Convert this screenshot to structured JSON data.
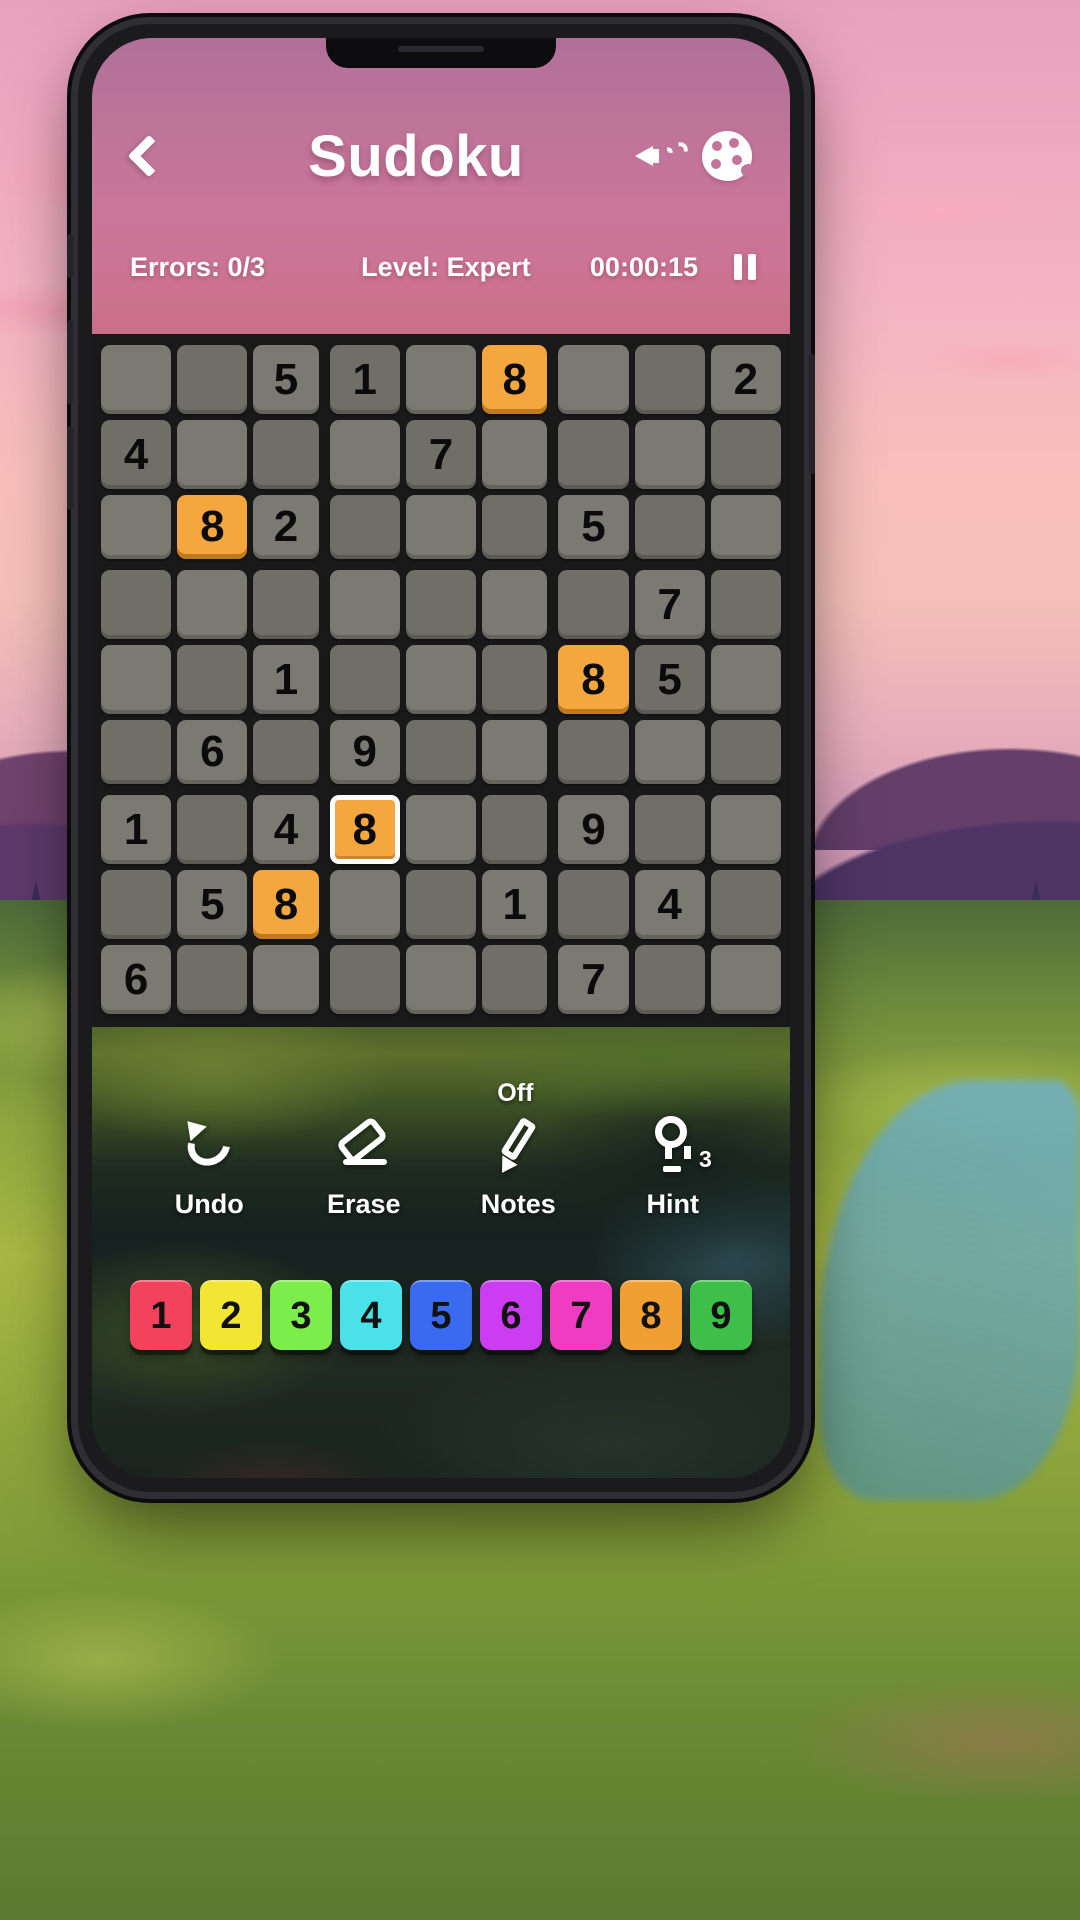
{
  "header": {
    "back_icon": "back-chevron-icon",
    "title": "Sudoku",
    "sound_icon": "sound-on-icon",
    "theme_icon": "palette-icon"
  },
  "status": {
    "errors": "Errors: 0/3",
    "level": "Level: Expert",
    "timer": "00:00:15",
    "pause_icon": "pause-icon"
  },
  "board": {
    "selected": {
      "row": 6,
      "col": 3
    },
    "highlight_value": "8",
    "rows": [
      [
        "",
        "",
        "5",
        "1",
        "",
        "8",
        "",
        "",
        "2"
      ],
      [
        "4",
        "",
        "",
        "",
        "7",
        "",
        "",
        "",
        ""
      ],
      [
        "",
        "8",
        "2",
        "",
        "",
        "",
        "5",
        "",
        ""
      ],
      [
        "",
        "",
        "",
        "",
        "",
        "",
        "",
        "7",
        ""
      ],
      [
        "",
        "",
        "1",
        "",
        "",
        "",
        "8",
        "5",
        ""
      ],
      [
        "",
        "6",
        "",
        "9",
        "",
        "",
        "",
        "",
        ""
      ],
      [
        "1",
        "",
        "4",
        "8",
        "",
        "",
        "9",
        "",
        ""
      ],
      [
        "",
        "5",
        "8",
        "",
        "",
        "1",
        "",
        "4",
        ""
      ],
      [
        "6",
        "",
        "",
        "",
        "",
        "",
        "7",
        "",
        ""
      ]
    ]
  },
  "tools": [
    {
      "id": "undo",
      "icon": "undo-icon",
      "label": "Undo",
      "badge": ""
    },
    {
      "id": "erase",
      "icon": "eraser-icon",
      "label": "Erase",
      "badge": ""
    },
    {
      "id": "notes",
      "icon": "pencil-icon",
      "label": "Notes",
      "badge": "Off"
    },
    {
      "id": "hint",
      "icon": "bulb-icon",
      "label": "Hint",
      "badge": "3"
    }
  ],
  "numpad": [
    {
      "label": "1",
      "color": "#f2425c"
    },
    {
      "label": "2",
      "color": "#f2e534"
    },
    {
      "label": "3",
      "color": "#7ced4a"
    },
    {
      "label": "4",
      "color": "#4ae2e8"
    },
    {
      "label": "5",
      "color": "#3a6af0"
    },
    {
      "label": "6",
      "color": "#cc3cf0"
    },
    {
      "label": "7",
      "color": "#f03cc0"
    },
    {
      "label": "8",
      "color": "#f0a033"
    },
    {
      "label": "9",
      "color": "#3dbf4a"
    }
  ],
  "colors": {
    "header_top": "#b17099",
    "header_bottom": "#c96f8b",
    "tile": "#7b7a72",
    "tile_highlight": "#f4a63f",
    "board_bg": "#191919"
  }
}
